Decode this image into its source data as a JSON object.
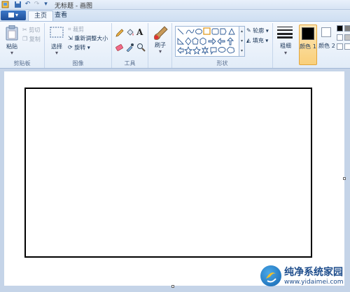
{
  "titlebar": {
    "title": "无标题 - 画图"
  },
  "tabs": {
    "file_label": "▾",
    "home": "主页",
    "view": "查看"
  },
  "ribbon": {
    "clipboard": {
      "paste": "粘贴",
      "cut": "剪切",
      "copy": "复制",
      "label": "剪贴板"
    },
    "image": {
      "select": "选择",
      "crop": "裁剪",
      "resize": "重新调整大小",
      "rotate": "旋转",
      "label": "图像"
    },
    "tools": {
      "label": "工具"
    },
    "brushes": {
      "label": "刷子"
    },
    "shapes": {
      "outline": "轮廓",
      "fill": "填充",
      "label": "形状"
    },
    "size": {
      "label": "粗细"
    },
    "colors": {
      "color1": "颜色 1",
      "color2": "颜色 2",
      "color1_value": "#000000",
      "color2_value": "#ffffff"
    }
  },
  "watermark": {
    "name": "纯净系统家园",
    "url": "www.yidaimei.com"
  }
}
